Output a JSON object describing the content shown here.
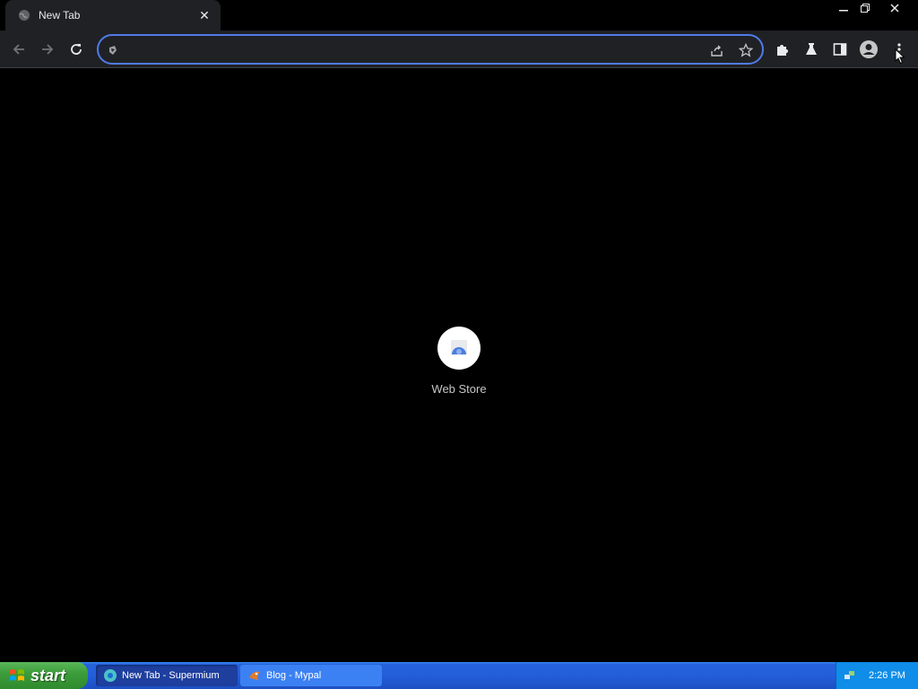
{
  "browser": {
    "tab": {
      "title": "New Tab",
      "close_symbol": "✕"
    },
    "window_controls": {
      "minimize": "─",
      "restore": "❐",
      "close": "✕"
    },
    "omnibox": {
      "value": "",
      "placeholder": ""
    }
  },
  "ntp": {
    "shortcuts": [
      {
        "label": "Web Store"
      }
    ]
  },
  "taskbar": {
    "start_label": "start",
    "tasks": [
      {
        "label": "New Tab - Supermium",
        "active": true
      },
      {
        "label": "Blog - Mypal",
        "active": false
      }
    ],
    "clock": "2:26 PM"
  },
  "colors": {
    "accent_focus": "#4f7be8",
    "toolbar_bg": "#202124",
    "page_bg": "#000000",
    "taskbar_blue": "#245edb",
    "start_green": "#3c9d3a"
  }
}
